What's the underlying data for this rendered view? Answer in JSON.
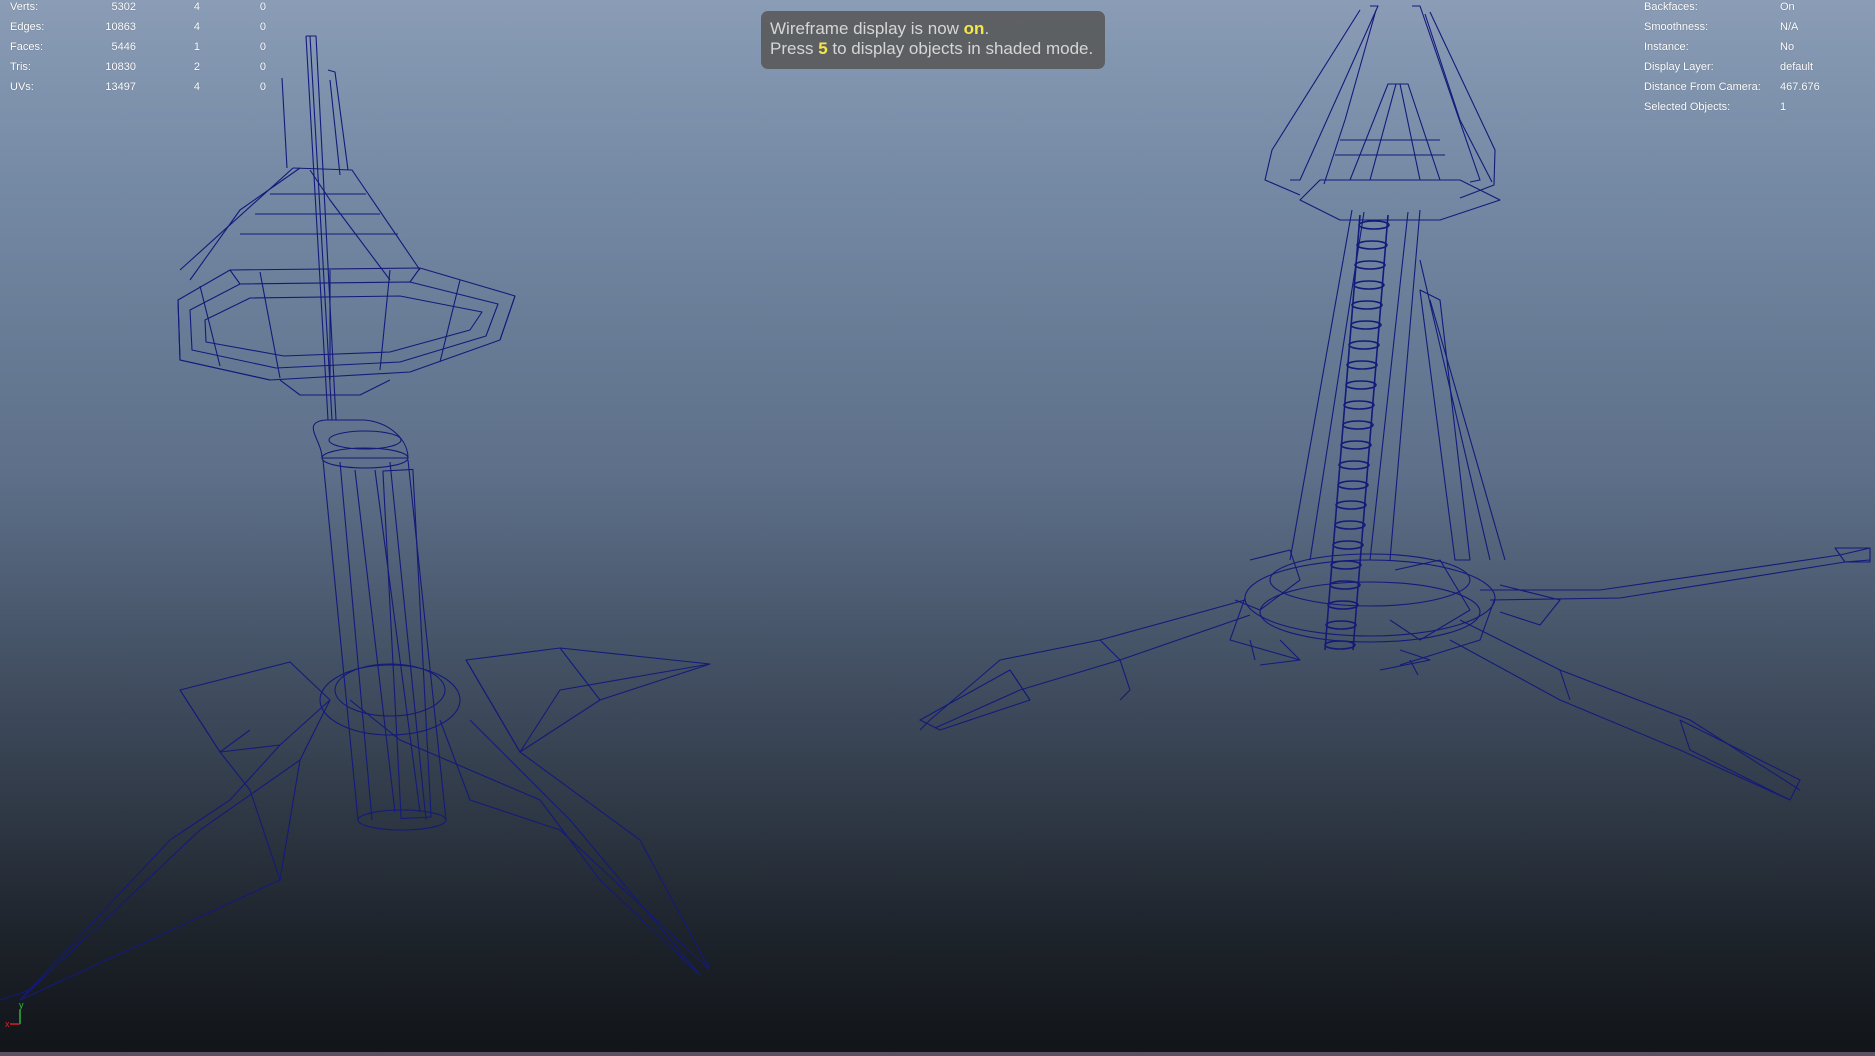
{
  "hud_left": {
    "rows": [
      {
        "label": "Verts:",
        "v1": "5302",
        "v2": "4",
        "v3": "0"
      },
      {
        "label": "Edges:",
        "v1": "10863",
        "v2": "4",
        "v3": "0"
      },
      {
        "label": "Faces:",
        "v1": "5446",
        "v2": "1",
        "v3": "0"
      },
      {
        "label": "Tris:",
        "v1": "10830",
        "v2": "2",
        "v3": "0"
      },
      {
        "label": "UVs:",
        "v1": "13497",
        "v2": "4",
        "v3": "0"
      }
    ]
  },
  "hud_right": {
    "rows": [
      {
        "label": "Backfaces:",
        "value": "On"
      },
      {
        "label": "Smoothness:",
        "value": "N/A"
      },
      {
        "label": "Instance:",
        "value": "No"
      },
      {
        "label": "Display Layer:",
        "value": "default"
      },
      {
        "label": "Distance From Camera:",
        "value": "467.676"
      },
      {
        "label": "Selected Objects:",
        "value": "1"
      }
    ]
  },
  "message": {
    "line1_prefix": "Wireframe display is now ",
    "line1_highlight": "on",
    "line1_suffix": ".",
    "line2_prefix": "Press ",
    "line2_highlight": "5",
    "line2_suffix": " to display objects in shaded mode."
  },
  "axis": {
    "x_label": "x",
    "y_label": "y"
  },
  "colors": {
    "wire": "#141a7a",
    "highlight": "#f5e64a",
    "axis_x": "#e0202a",
    "axis_y": "#30c040",
    "hud_text": "#ffffff"
  }
}
